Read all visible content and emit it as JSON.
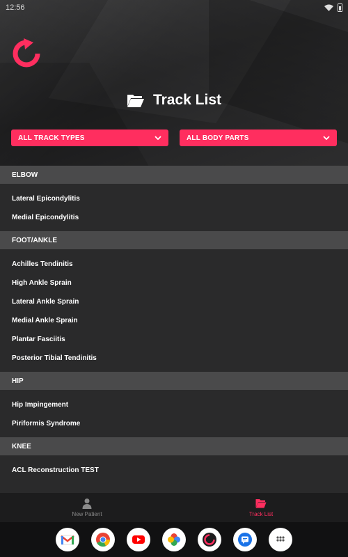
{
  "status_bar": {
    "time": "12:56"
  },
  "header": {
    "title": "Track List"
  },
  "filters": {
    "track_type": "ALL TRACK TYPES",
    "body_part": "ALL BODY PARTS"
  },
  "sections": [
    {
      "title": "ELBOW",
      "items": [
        "Lateral Epicondylitis",
        "Medial Epicondylitis"
      ]
    },
    {
      "title": "FOOT/ANKLE",
      "items": [
        "Achilles Tendinitis",
        "High Ankle Sprain",
        "Lateral Ankle Sprain",
        "Medial Ankle Sprain",
        "Plantar Fasciitis",
        "Posterior Tibial Tendinitis"
      ]
    },
    {
      "title": "HIP",
      "items": [
        "Hip Impingement",
        "Piriformis Syndrome"
      ]
    },
    {
      "title": "KNEE",
      "items": [
        "ACL Reconstruction TEST"
      ]
    }
  ],
  "bottom_nav": {
    "new_patient": "New Patient",
    "track_list": "Track List"
  },
  "dock": [
    "gmail-icon",
    "chrome-icon",
    "youtube-icon",
    "photos-icon",
    "app-logo-icon",
    "messages-icon",
    "app-drawer-icon"
  ],
  "colors": {
    "accent": "#ff2e5f",
    "background": "#2a2a2b",
    "section_header": "#4a4a4b"
  }
}
